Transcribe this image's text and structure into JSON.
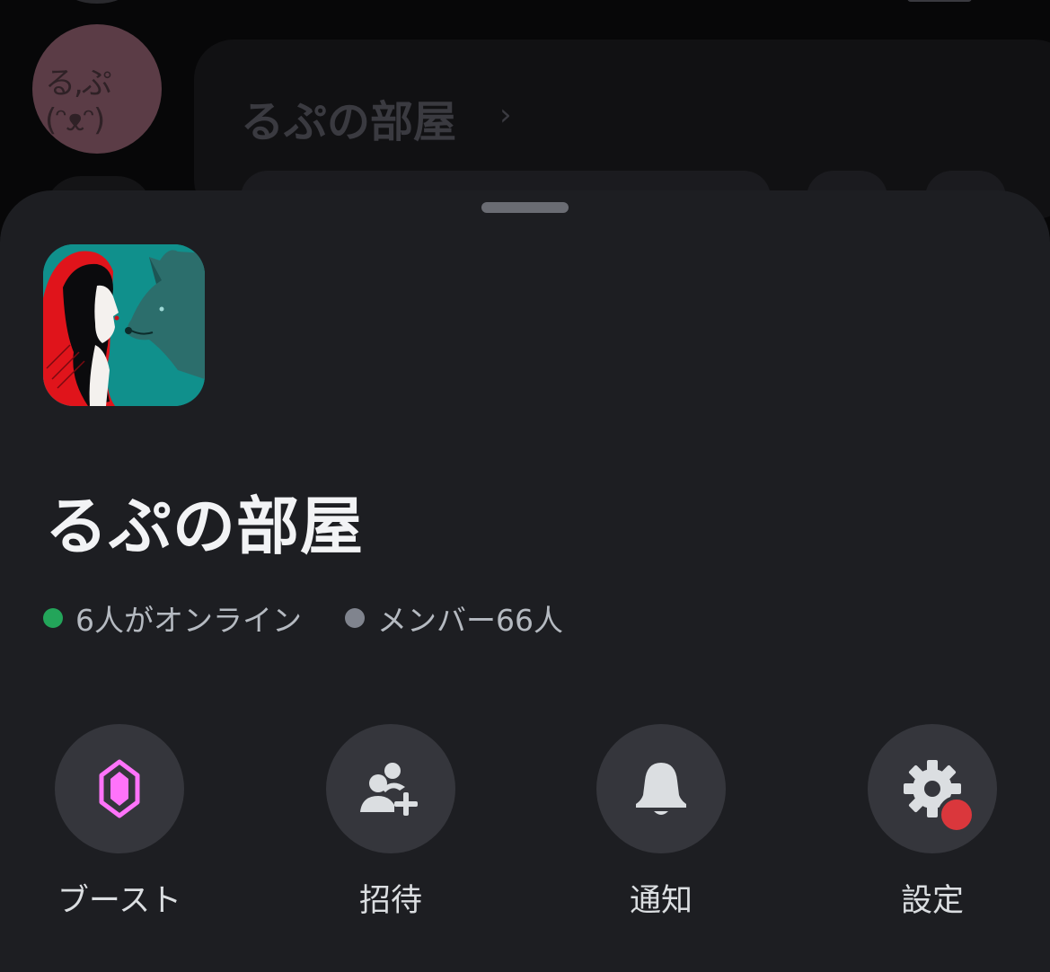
{
  "background": {
    "title": "るぷの部屋",
    "chevron_icon": "chevron-right-icon"
  },
  "server": {
    "name": "るぷの部屋",
    "icon": "server-icon-red-hood-and-wolf"
  },
  "stats": {
    "online_text": "6人がオンライン",
    "online_color": "#23a55a",
    "members_text": "メンバー66人",
    "members_color": "#80848e"
  },
  "actions": [
    {
      "label": "ブースト",
      "icon": "boost-gem-icon",
      "color": "#ff73fa"
    },
    {
      "label": "招待",
      "icon": "add-friend-icon",
      "color": "#dbdee1"
    },
    {
      "label": "通知",
      "icon": "bell-icon",
      "color": "#dbdee1"
    },
    {
      "label": "設定",
      "icon": "gear-icon",
      "color": "#dbdee1",
      "badge": true
    }
  ],
  "colors": {
    "sheet": "#1d1e22",
    "button": "#35363c",
    "badge": "#da373c"
  }
}
